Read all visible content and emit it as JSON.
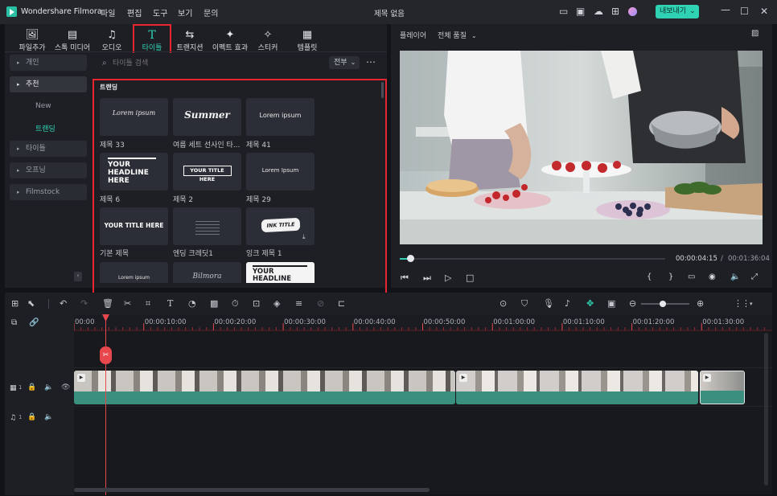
{
  "app": {
    "name": "Wondershare Filmora",
    "project_title": "제목 없음",
    "export_label": "내보내기"
  },
  "menu": [
    "파일",
    "편집",
    "도구",
    "보기",
    "문의"
  ],
  "toolbar": [
    {
      "label": "파일추가",
      "icon": "import-icon"
    },
    {
      "label": "스톡 미디어",
      "icon": "stock-media-icon"
    },
    {
      "label": "오디오",
      "icon": "audio-icon"
    },
    {
      "label": "타이틀",
      "icon": "title-icon",
      "active": true
    },
    {
      "label": "트랜지션",
      "icon": "transition-icon"
    },
    {
      "label": "이펙트 효과",
      "icon": "effects-icon"
    },
    {
      "label": "스티커",
      "icon": "sticker-icon"
    },
    {
      "label": "템플릿",
      "icon": "template-icon"
    }
  ],
  "sidebar": {
    "personal": "개인",
    "recommended": "추천",
    "new": "New",
    "trending": "트랜딩",
    "titles": "타이틀",
    "opening": "오프닝",
    "filmstock": "Filmstock"
  },
  "search": {
    "placeholder": "타이틀 검색",
    "filter": "전부"
  },
  "section_title": "트랜딩",
  "thumbs": [
    {
      "label": "제목 33",
      "art": "Lorem ipsum"
    },
    {
      "label": "여름 세트 선사인 타...",
      "art": "Summer"
    },
    {
      "label": "제목 41",
      "art": "Lorem ipsum"
    },
    {
      "label": "제목 6",
      "art": "YOUR HEADLINE HERE"
    },
    {
      "label": "제목 2",
      "art": "YOUR TITLE HERE"
    },
    {
      "label": "제목 29",
      "art": "Lorem Ipsum"
    },
    {
      "label": "기본 제목",
      "art": "YOUR TITLE HERE"
    },
    {
      "label": "엔딩 크레딧1",
      "art": ""
    },
    {
      "label": "잉크 제목 1",
      "art": "INK TITLE"
    },
    {
      "label": "",
      "art": "Lorem ipsum"
    },
    {
      "label": "",
      "art": "Bilmora"
    },
    {
      "label": "",
      "art": "YOUR HEADLINE"
    }
  ],
  "player": {
    "label": "플레이어",
    "quality": "전체 품질",
    "current_time": "00:00:04:15",
    "total_time": "00:01:36:04",
    "progress": 0.04
  },
  "timeline": {
    "ticks": [
      "00:00",
      "00:00:10:00",
      "00:00:20:00",
      "00:00:30:00",
      "00:00:40:00",
      "00:00:50:00",
      "00:01:00:00",
      "00:01:10:00",
      "00:01:20:00",
      "00:01:30:00"
    ],
    "video_track": "1",
    "audio_track": "1"
  },
  "colors": {
    "accent": "#2fd3b3",
    "highlight": "#e8262f",
    "clip": "#3a8f7e"
  }
}
